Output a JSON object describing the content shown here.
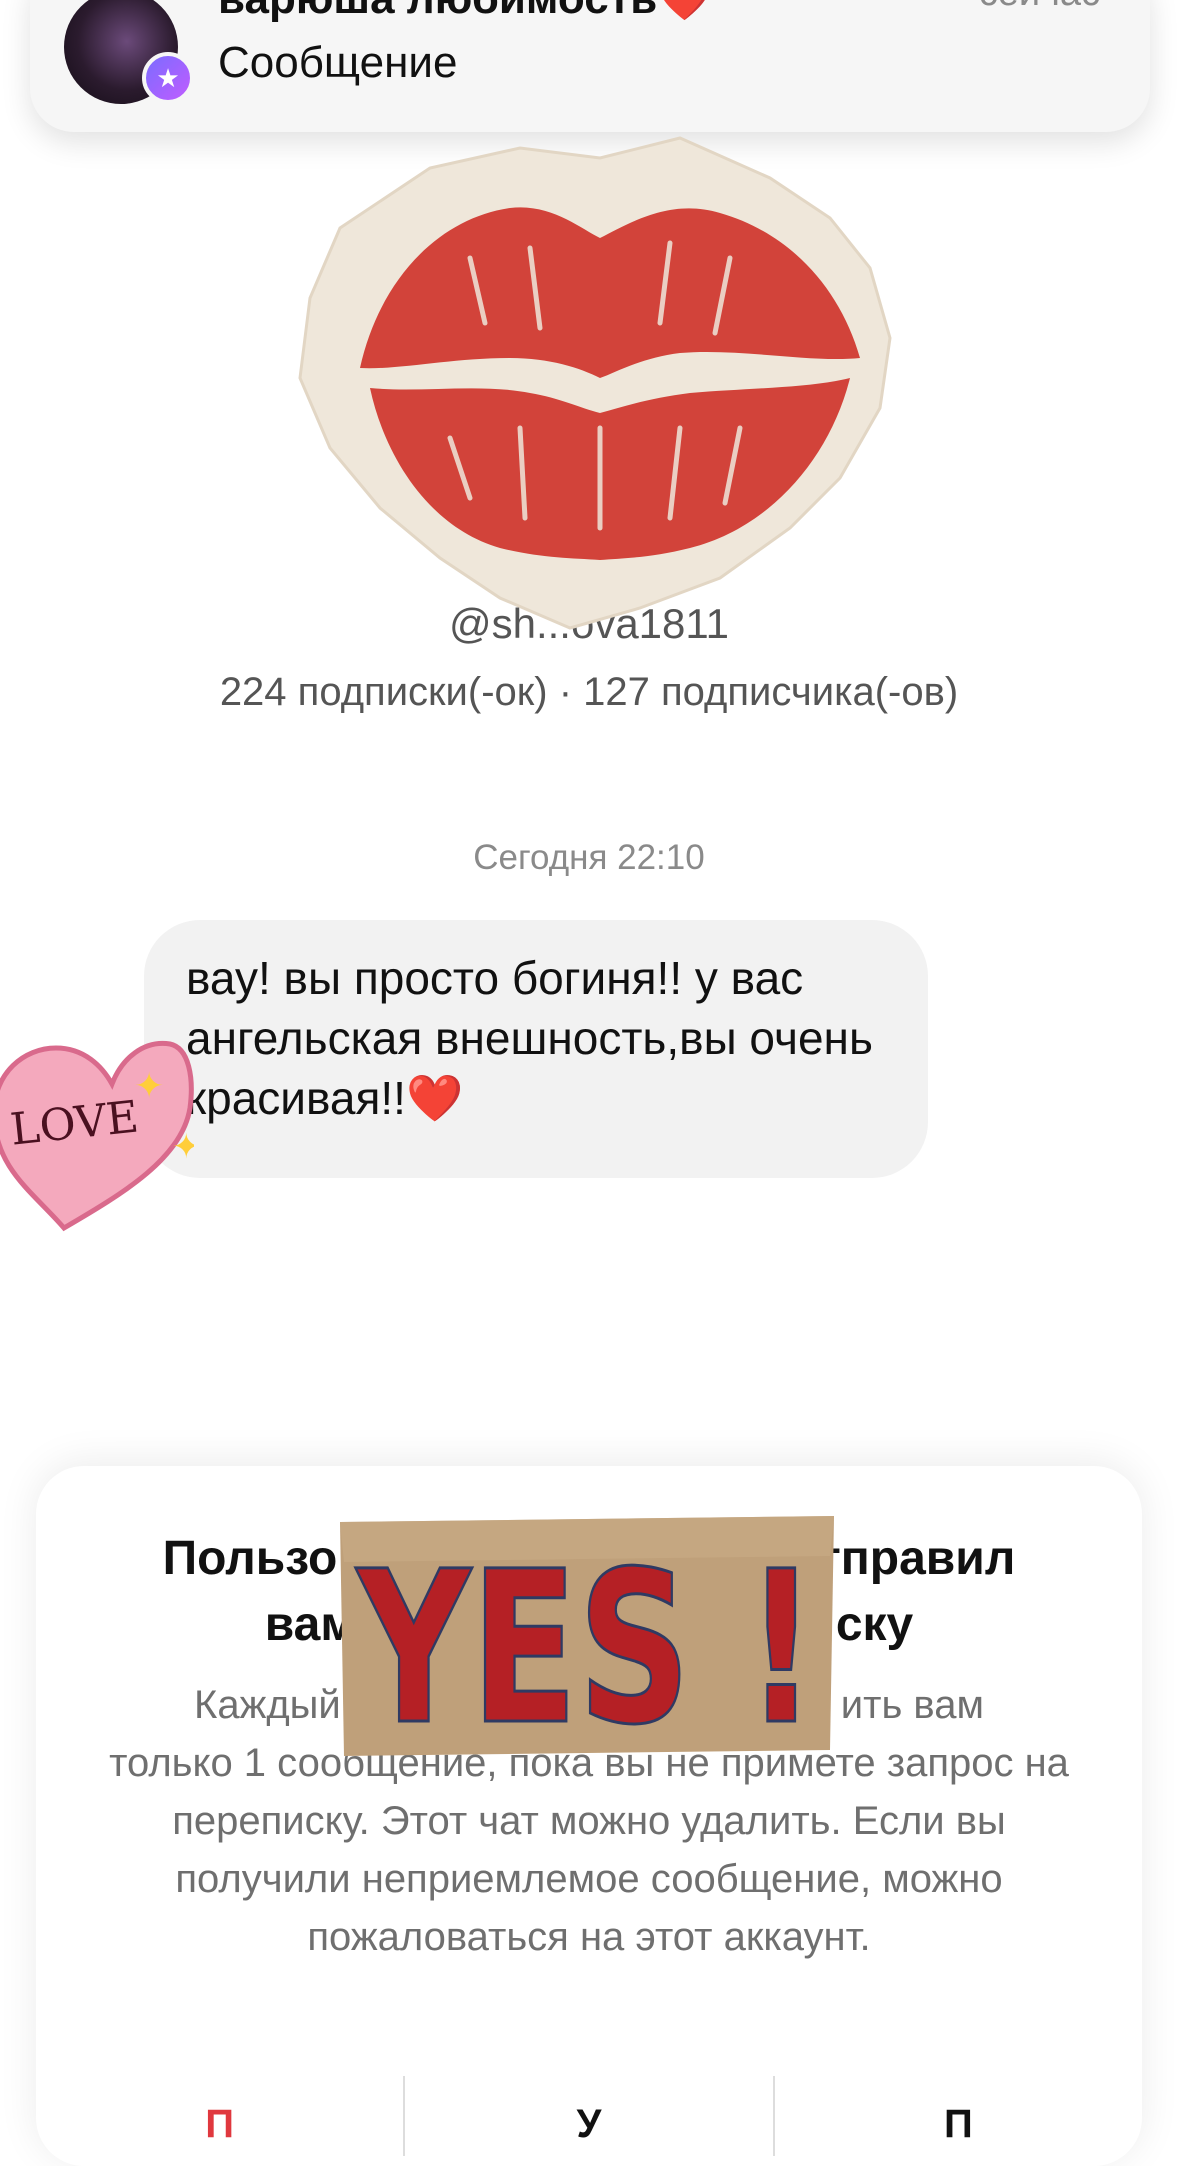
{
  "notification": {
    "title": "варюша любимость❤️",
    "subtitle": "Сообщение",
    "time": "сейчас",
    "avatar_icon": "profile-photo",
    "badge_icon": "star-icon"
  },
  "profile": {
    "handle": "@sh...ova1811",
    "stats": "224 подписки(-ок) · 127 подписчика(-ов)"
  },
  "chat": {
    "date": "Сегодня 22:10",
    "message": "вау! вы просто богиня!! у вас ангельская внешность,вы очень красивая!!❤️"
  },
  "stickers": {
    "lips": "lips-sticker",
    "heart_text": "LOVE",
    "yes_text": "YES !"
  },
  "request_card": {
    "title": "Пользо[скрыто]тправил вам [скрыто]ску",
    "title_visible_left": "Пользо",
    "title_visible_right": "тправил",
    "title_line2_left": "вам",
    "title_line2_right": "ску",
    "body": "Каждый [скрыто]ить вам только 1 сообщение, пока вы не примете запрос на переписку. Этот чат можно удалить. Если вы получили неприемлемое сообщение, можно пожаловаться на этот аккаунт.",
    "body_line1_left": "Каждый",
    "body_line1_right": "ить вам",
    "body_rest": "только 1 сообщение, пока вы не примете запрос на переписку. Этот чат можно удалить. Если вы получили неприемлемое сообщение, можно пожаловаться на этот аккаунт.",
    "actions": [
      "П",
      "У",
      "П"
    ]
  },
  "colors": {
    "lips_red": "#d2433a",
    "paper": "#efe7da",
    "heart_pink": "#f4a9bd",
    "yes_red": "#b52025",
    "kraft": "#bfa07a"
  }
}
